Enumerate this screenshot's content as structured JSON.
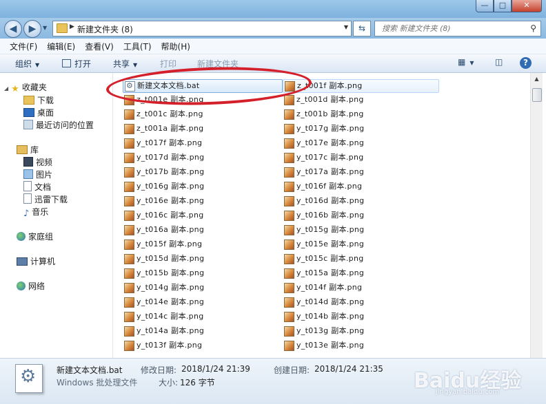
{
  "window": {
    "min": "—",
    "max": "□",
    "close": "✕"
  },
  "address": {
    "path": "新建文件夹 (8)",
    "search_placeholder": "搜索 新建文件夹 (8)"
  },
  "menu": [
    "文件(F)",
    "编辑(E)",
    "查看(V)",
    "工具(T)",
    "帮助(H)"
  ],
  "toolbar": {
    "organize": "组织",
    "open": "打开",
    "share": "共享",
    "print": "打印",
    "new_folder": "新建文件夹"
  },
  "nav": {
    "favorites": "收藏夹",
    "downloads": "下载",
    "desktop": "桌面",
    "recent": "最近访问的位置",
    "libraries": "库",
    "videos": "视频",
    "pictures": "图片",
    "documents": "文档",
    "thunder": "迅雷下载",
    "music": "音乐",
    "homegroup": "家庭组",
    "computer": "计算机",
    "network": "网络"
  },
  "files": {
    "col1": [
      "新建文本文档.bat",
      "z_t001e 副本.png",
      "z_t001c 副本.png",
      "z_t001a 副本.png",
      "y_t017f 副本.png",
      "y_t017d 副本.png",
      "y_t017b 副本.png",
      "y_t016g 副本.png",
      "y_t016e 副本.png",
      "y_t016c 副本.png",
      "y_t016a 副本.png",
      "y_t015f 副本.png",
      "y_t015d 副本.png",
      "y_t015b 副本.png",
      "y_t014g 副本.png",
      "y_t014e 副本.png",
      "y_t014c 副本.png",
      "y_t014a 副本.png",
      "y_t013f 副本.png"
    ],
    "col2": [
      "z_t001f 副本.png",
      "z_t001d 副本.png",
      "z_t001b 副本.png",
      "y_t017g 副本.png",
      "y_t017e 副本.png",
      "y_t017c 副本.png",
      "y_t017a 副本.png",
      "y_t016f 副本.png",
      "y_t016d 副本.png",
      "y_t016b 副本.png",
      "y_t015g 副本.png",
      "y_t015e 副本.png",
      "y_t015c 副本.png",
      "y_t015a 副本.png",
      "y_t014f 副本.png",
      "y_t014d 副本.png",
      "y_t014b 副本.png",
      "y_t013g 副本.png",
      "y_t013e 副本.png"
    ]
  },
  "details": {
    "name": "新建文本文档.bat",
    "type": "Windows 批处理文件",
    "modified_label": "修改日期:",
    "modified_value": "2018/1/24 21:39",
    "created_label": "创建日期:",
    "created_value": "2018/1/24 21:35",
    "size_label": "大小:",
    "size_value": "126 字节"
  },
  "watermark": {
    "brand": "Baidu经验",
    "url": "jingyan.baidu.com"
  },
  "colors": {
    "annotation_red": "#d4202a",
    "selection": "#d8eafb"
  }
}
